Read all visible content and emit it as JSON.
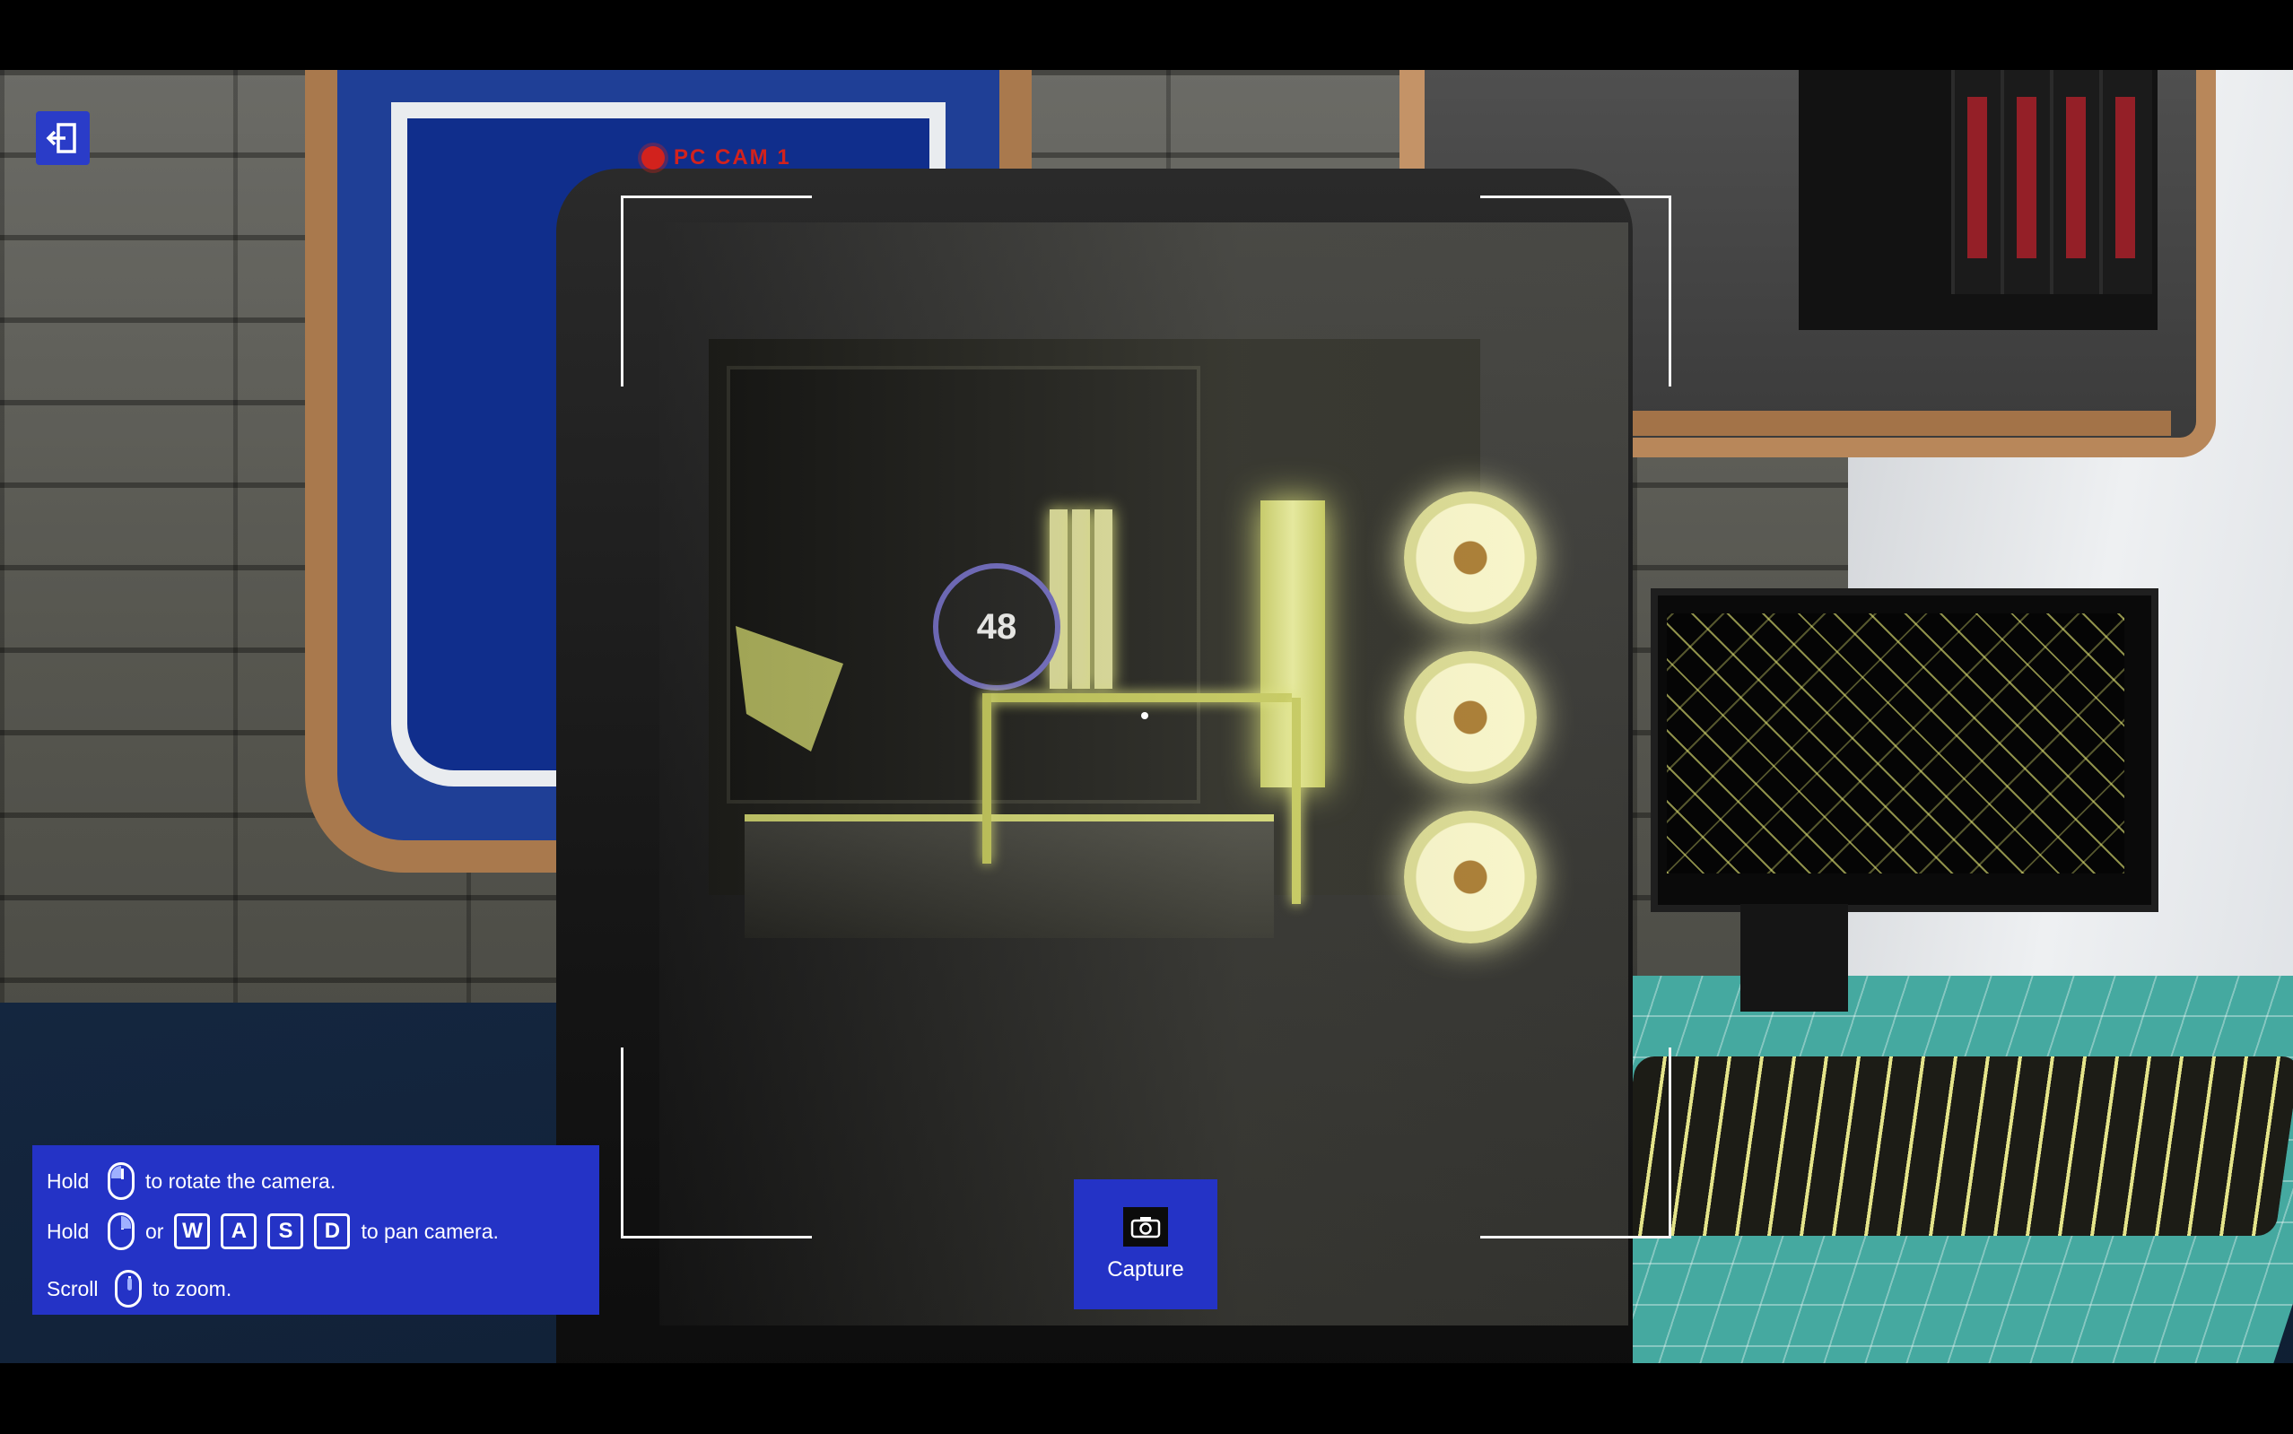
{
  "hud": {
    "camera_label": "PC CAM 1",
    "exit_icon": "exit-icon"
  },
  "controls": {
    "row1": {
      "prefix": "Hold",
      "icon": "mouse-left-icon",
      "text": "to rotate the camera."
    },
    "row2": {
      "prefix": "Hold",
      "icon": "mouse-right-icon",
      "or": "or",
      "keys": [
        "W",
        "A",
        "S",
        "D"
      ],
      "text": "to pan camera."
    },
    "row3": {
      "prefix": "Scroll",
      "icon": "mouse-scroll-icon",
      "text": "to zoom."
    }
  },
  "capture": {
    "label": "Capture",
    "icon": "camera-icon"
  },
  "scene": {
    "pump_display": "48"
  },
  "colors": {
    "hud_panel": "#2433c6",
    "rec_red": "#d2221d",
    "accent_yellow": "#e4e48a"
  }
}
